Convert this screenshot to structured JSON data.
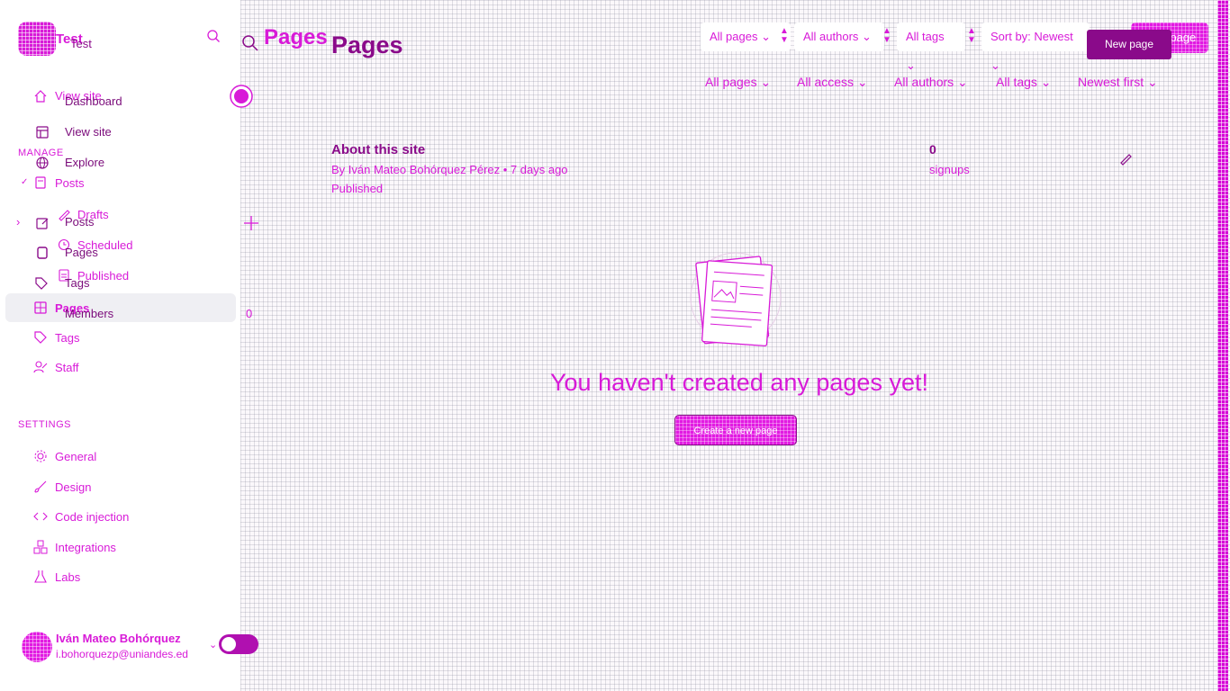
{
  "app": {
    "site_title": "Test",
    "site_title_alt": "Test"
  },
  "sidebar": {
    "top_items": [
      {
        "label": "View site",
        "icon": "home-icon"
      },
      {
        "label": "Dashboard",
        "icon": "dashboard-icon"
      },
      {
        "label": "View site",
        "icon": "external-icon"
      },
      {
        "label": "Explore",
        "icon": "globe-icon"
      }
    ],
    "manage_title": "MANAGE",
    "manage_items": [
      {
        "label": "Posts",
        "icon": "document-icon"
      },
      {
        "label": "Drafts"
      },
      {
        "label": "Posts",
        "icon": "edit-icon"
      },
      {
        "label": "Scheduled"
      },
      {
        "label": "Pages",
        "icon": "page-icon"
      },
      {
        "label": "Published"
      },
      {
        "label": "Tags",
        "icon": "tag-icon"
      },
      {
        "label": "Pages",
        "icon": "pages-icon"
      },
      {
        "label": "Members"
      },
      {
        "label": "Tags",
        "icon": "tag-icon"
      },
      {
        "label": "Staff",
        "icon": "staff-icon"
      }
    ],
    "settings_title": "SETTINGS",
    "settings_items": [
      {
        "label": "General",
        "icon": "gear-icon"
      },
      {
        "label": "Design",
        "icon": "brush-icon"
      },
      {
        "label": "Code injection",
        "icon": "code-icon"
      },
      {
        "label": "Integrations",
        "icon": "integrations-icon"
      },
      {
        "label": "Labs",
        "icon": "labs-icon"
      }
    ],
    "members_count": "0",
    "user": {
      "name": "Iván Mateo Bohórquez",
      "email": "i.bohorquezp@uniandes.ed"
    }
  },
  "header": {
    "title": "Pages",
    "title_alt": "Pages",
    "filters_row1": [
      "All pages",
      "All authors",
      "All tags",
      "Sort by: Newest"
    ],
    "new_button": "New page",
    "new_button_alt": "New page",
    "filters_row2": [
      "All pages",
      "All access",
      "All authors",
      "All tags",
      "Newest first"
    ]
  },
  "list": {
    "rows": [
      {
        "title": "About this site",
        "meta": "By Iván Mateo Bohórquez Pérez • 7 days ago",
        "status": "Published",
        "count": "0",
        "count_label": "signups"
      }
    ]
  },
  "empty_state": {
    "message": "You haven't created any pages yet!",
    "button": "Create a new page"
  },
  "colors": {
    "accent": "#d81ad8",
    "dark_accent": "#8a0a8a"
  }
}
